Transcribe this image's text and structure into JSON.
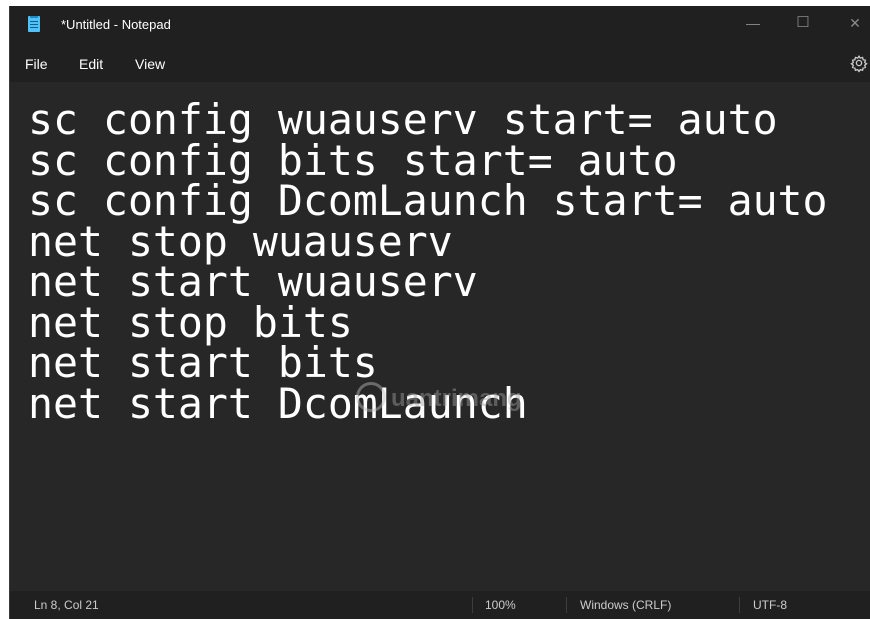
{
  "window": {
    "title": "*Untitled - Notepad",
    "controls": {
      "minimize": "—",
      "maximize": "☐",
      "close": "✕"
    }
  },
  "menu": {
    "file": "File",
    "edit": "Edit",
    "view": "View"
  },
  "editor": {
    "text": "sc config wuauserv start= auto\nsc config bits start= auto\nsc config DcomLaunch start= auto\nnet stop wuauserv\nnet start wuauserv\nnet stop bits\nnet start bits\nnet start DcomLaunch"
  },
  "watermark": {
    "text": "uantrimang"
  },
  "status": {
    "position": "Ln 8, Col 21",
    "zoom": "100%",
    "line_ending": "Windows (CRLF)",
    "encoding": "UTF-8"
  },
  "icons": {
    "app": "notepad-icon",
    "settings": "gear-icon"
  },
  "colors": {
    "background": "#272727",
    "chrome": "#202020",
    "text": "#ffffff"
  }
}
